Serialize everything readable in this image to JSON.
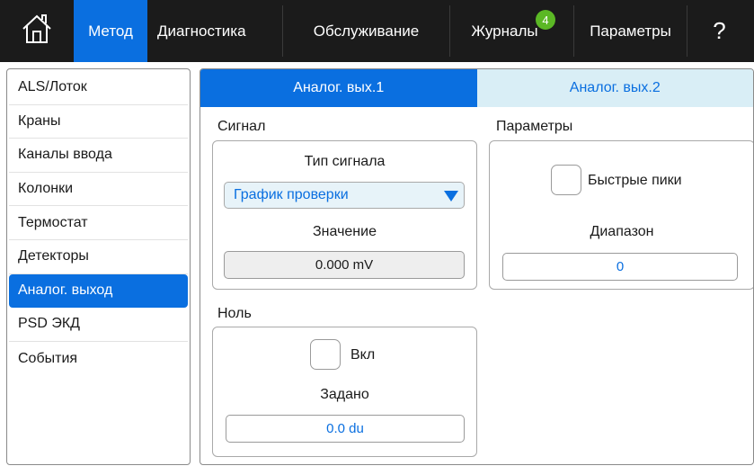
{
  "nav": {
    "home_icon": "home-icon",
    "tabs": [
      {
        "label": "Метод",
        "active": true
      },
      {
        "label": "Диагностика",
        "active": false
      },
      {
        "label": "Обслуживание",
        "active": false
      },
      {
        "label": "Журналы",
        "active": false,
        "badge": "4"
      },
      {
        "label": "Параметры",
        "active": false
      }
    ],
    "help_label": "?"
  },
  "sidebar": {
    "items": [
      {
        "label": "ALS/Лоток"
      },
      {
        "label": "Краны"
      },
      {
        "label": "Каналы ввода"
      },
      {
        "label": "Колонки"
      },
      {
        "label": "Термостат"
      },
      {
        "label": "Детекторы"
      },
      {
        "label": "Аналог. выход",
        "active": true
      },
      {
        "label": "PSD ЭКД"
      },
      {
        "label": "События"
      }
    ]
  },
  "main": {
    "tabs": [
      {
        "label": "Аналог. вых.1",
        "active": true
      },
      {
        "label": "Аналог. вых.2",
        "active": false
      }
    ],
    "signal": {
      "section_label": "Сигнал",
      "type_label": "Тип сигнала",
      "type_value": "График проверки",
      "value_label": "Значение",
      "value": "0.000 mV"
    },
    "params": {
      "section_label": "Параметры",
      "fast_peaks_label": "Быстрые пики",
      "fast_peaks_checked": false,
      "range_label": "Диапазон",
      "range_value": "0"
    },
    "zero": {
      "section_label": "Ноль",
      "on_label": "Вкл",
      "on_checked": false,
      "set_label": "Задано",
      "set_value": "0.0 du"
    }
  },
  "colors": {
    "accent": "#0a6fe0",
    "topbar_bg": "#1b1b1b",
    "badge": "#5bb825",
    "inactive_tab_bg": "#d9eef6"
  }
}
